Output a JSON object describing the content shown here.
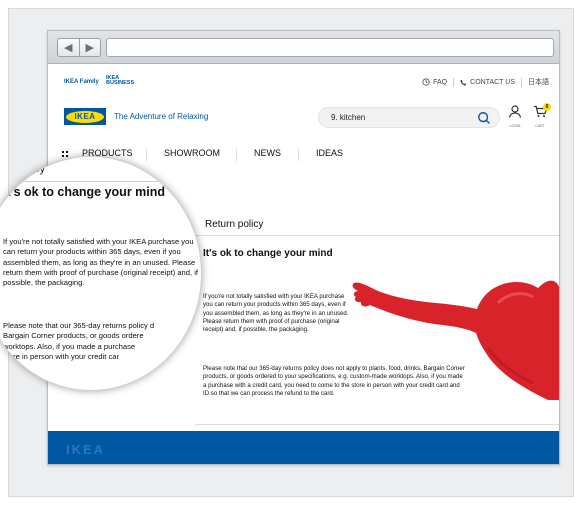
{
  "header_top": {
    "family_link": "IKEA Family",
    "business_link_line1": "IKEA",
    "business_link_line2": "BUSINESS",
    "faq": "FAQ",
    "contact": "CONTACT US",
    "language": "日本語"
  },
  "header": {
    "logo": "IKEA",
    "tagline": "The Adventure of Relaxing",
    "search_value": "9. kitchen",
    "login_label": "LOGIN",
    "cart_label": "CART",
    "cart_count": "0"
  },
  "nav": {
    "items": [
      "PRODUCTS",
      "SHOWROOM",
      "NEWS",
      "IDEAS"
    ]
  },
  "page": {
    "section_title": "Return policy",
    "heading": "It's ok to change your mind",
    "paragraph1": "If you're not totally satisfied with your IKEA purchase you can return your products within 365 days, even if you assembled them, as long as they're in an unused. Please return them with proof of purchase (original receipt) and, if possible, the packaging.",
    "paragraph2": "Please note that our 365-day returns policy does not apply to plants, food, drinks, Bargain Corner products, or goods ordered to your specifications, e.g. custom-made worktops. Also, if you made a purchase with a credit card, you need to come to the store in person with your credit card and ID so that we can process the refund to the card."
  },
  "magnifier": {
    "policy_fragment": "policy",
    "heading": "It's ok to change your mind",
    "paragraph1": "If you're not totally satisfied with your IKEA purchase you can return your products within 365 days, even if you assembled them, as long as they're in an unused. Please return them with proof of purchase (original receipt) and, if possible, the packaging.",
    "paragraph2_lines": [
      "Please note that our 365-day returns policy d",
      "Bargain Corner products, or goods ordere",
      "worktops. Also, if you made a purchase",
      "store in person with your credit car"
    ]
  },
  "footer": {
    "logo": "IKEA"
  },
  "colors": {
    "ikea_blue": "#0058a3",
    "ikea_yellow": "#ffdb00",
    "heart_red": "#d9232a"
  }
}
